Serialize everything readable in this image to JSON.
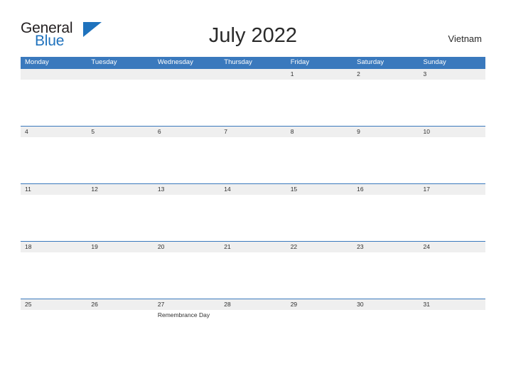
{
  "logo": {
    "word_one": "General",
    "word_two": "Blue",
    "flag_icon": "blue-flag-triangle-icon",
    "color_dark": "#231f20",
    "color_blue": "#1f72bd"
  },
  "header": {
    "title": "July 2022",
    "region": "Vietnam"
  },
  "theme": {
    "header_blue": "#3a79bd",
    "date_band_gray": "#efefef",
    "text_dark": "#2f2f2f",
    "page_background": "#ffffff"
  },
  "calendar": {
    "month": "July",
    "year": "2022",
    "weekday_headers": [
      "Monday",
      "Tuesday",
      "Wednesday",
      "Thursday",
      "Friday",
      "Saturday",
      "Sunday"
    ],
    "weeks": [
      {
        "days": [
          {
            "date": "",
            "event": ""
          },
          {
            "date": "",
            "event": ""
          },
          {
            "date": "",
            "event": ""
          },
          {
            "date": "",
            "event": ""
          },
          {
            "date": "1",
            "event": ""
          },
          {
            "date": "2",
            "event": ""
          },
          {
            "date": "3",
            "event": ""
          }
        ]
      },
      {
        "days": [
          {
            "date": "4",
            "event": ""
          },
          {
            "date": "5",
            "event": ""
          },
          {
            "date": "6",
            "event": ""
          },
          {
            "date": "7",
            "event": ""
          },
          {
            "date": "8",
            "event": ""
          },
          {
            "date": "9",
            "event": ""
          },
          {
            "date": "10",
            "event": ""
          }
        ]
      },
      {
        "days": [
          {
            "date": "11",
            "event": ""
          },
          {
            "date": "12",
            "event": ""
          },
          {
            "date": "13",
            "event": ""
          },
          {
            "date": "14",
            "event": ""
          },
          {
            "date": "15",
            "event": ""
          },
          {
            "date": "16",
            "event": ""
          },
          {
            "date": "17",
            "event": ""
          }
        ]
      },
      {
        "days": [
          {
            "date": "18",
            "event": ""
          },
          {
            "date": "19",
            "event": ""
          },
          {
            "date": "20",
            "event": ""
          },
          {
            "date": "21",
            "event": ""
          },
          {
            "date": "22",
            "event": ""
          },
          {
            "date": "23",
            "event": ""
          },
          {
            "date": "24",
            "event": ""
          }
        ]
      },
      {
        "days": [
          {
            "date": "25",
            "event": ""
          },
          {
            "date": "26",
            "event": ""
          },
          {
            "date": "27",
            "event": "Remembrance Day"
          },
          {
            "date": "28",
            "event": ""
          },
          {
            "date": "29",
            "event": ""
          },
          {
            "date": "30",
            "event": ""
          },
          {
            "date": "31",
            "event": ""
          }
        ]
      }
    ]
  }
}
